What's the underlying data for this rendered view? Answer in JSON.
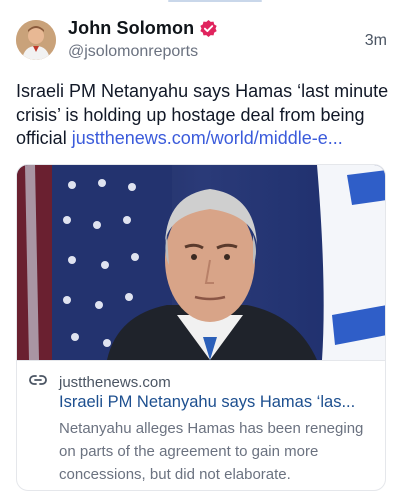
{
  "post": {
    "author": {
      "display_name": "John Solomon",
      "handle": "@jsolomonreports",
      "verified": true,
      "avatar_icon": "avatar-photo"
    },
    "timestamp": "3m",
    "text": "Israeli PM Netanyahu says Hamas ‘last minute crisis’ is holding up hostage deal from being official ",
    "link_text": "justthenews.com/world/middle-e...",
    "colors": {
      "link": "#3b5bdb",
      "verified_badge": "#e0245e"
    }
  },
  "link_card": {
    "image_icon": "news-photo",
    "domain": "justthenews.com",
    "domain_icon": "link-icon",
    "title": "Israeli PM Netanyahu says Hamas ‘las...",
    "description": "Netanyahu alleges Hamas has been reneging on parts of the agreement to gain more concessions, but did not elaborate."
  }
}
